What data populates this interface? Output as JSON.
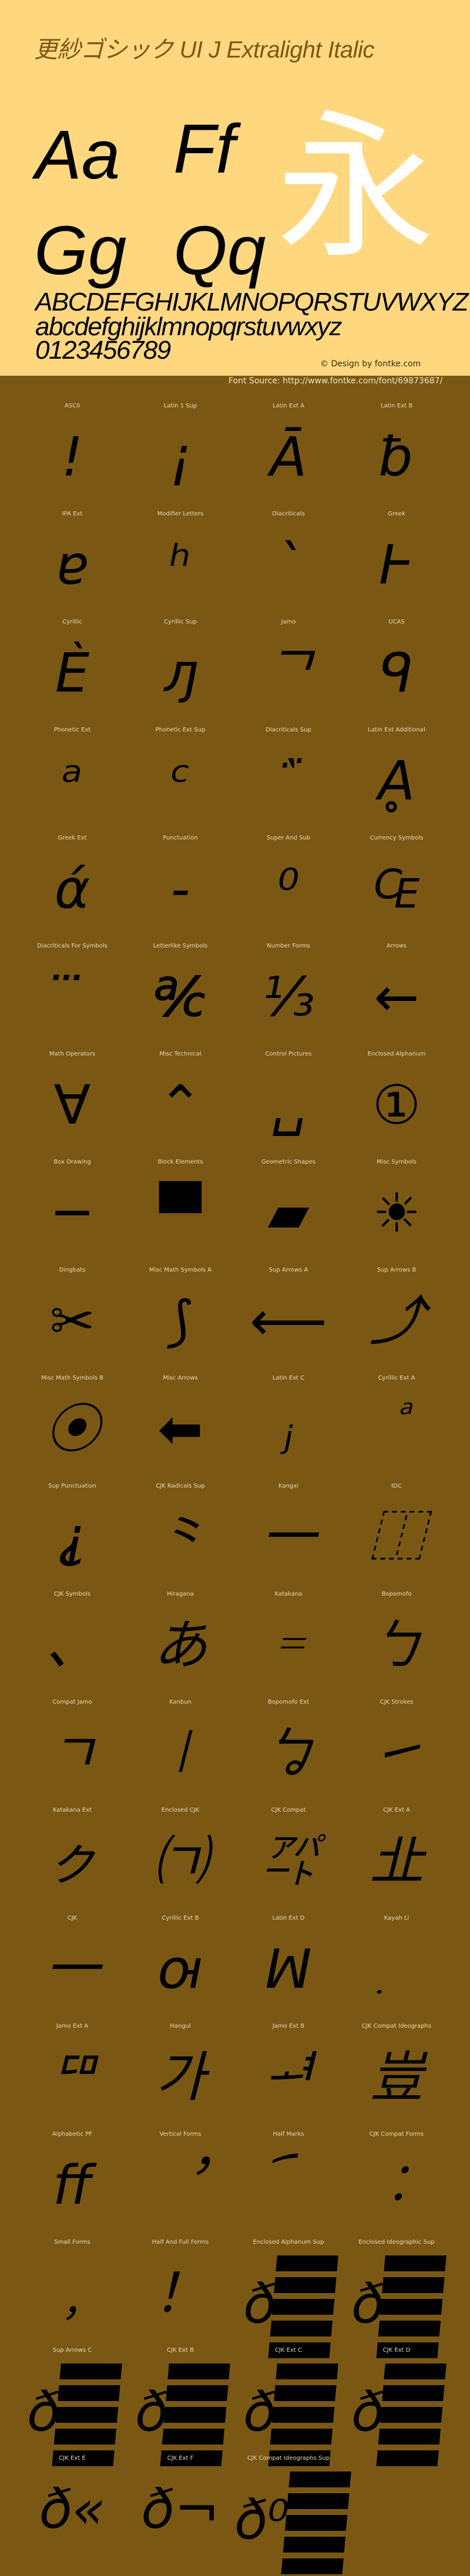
{
  "header": {
    "title": "更紗ゴシック UI J Extralight Italic",
    "sample_pairs": [
      "Aa",
      "Ff",
      "Gg",
      "Qq"
    ],
    "sample_kanji": "永",
    "uppercase": "ABCDEFGHIJKLMNOPQRSTUVWXYZ",
    "lowercase": "abcdefghijklmnopqrstuvwxyz",
    "digits": "0123456789",
    "design_credit": "© Design by fontke.com",
    "font_source": "Font Source: http://www.fontke.com/font/69873687/"
  },
  "colors": {
    "header_bg": "#FFD77F",
    "body_bg": "#7A5814",
    "glyph": "#000000",
    "label": "#EADCB8"
  },
  "blocks": [
    {
      "label": "ASCII",
      "glyph": "!"
    },
    {
      "label": "Latin 1 Sup",
      "glyph": "¡"
    },
    {
      "label": "Latin Ext A",
      "glyph": "Ā"
    },
    {
      "label": "Latin Ext B",
      "glyph": "ƀ"
    },
    {
      "label": "IPA Ext",
      "glyph": "ɐ"
    },
    {
      "label": "Modifier Letters",
      "glyph": "ʰ"
    },
    {
      "label": "Diacriticals",
      "glyph": "`"
    },
    {
      "label": "Greek",
      "glyph": "Ͱ"
    },
    {
      "label": "Cyrillic",
      "glyph": "Ѐ"
    },
    {
      "label": "Cyrillic Sup",
      "glyph": "ԓ"
    },
    {
      "label": "Jamo",
      "glyph": "ᄀ"
    },
    {
      "label": "UCAS",
      "glyph": "ᑫ"
    },
    {
      "label": "Phonetic Ext",
      "glyph": "ᵃ"
    },
    {
      "label": "Phonetic Ext Sup",
      "glyph": "ᶜ"
    },
    {
      "label": "Diacriticals Sup",
      "glyph": "᷀"
    },
    {
      "label": "Latin Ext Additional",
      "glyph": "Ḁ"
    },
    {
      "label": "Greek Ext",
      "glyph": "ά"
    },
    {
      "label": "Punctuation",
      "glyph": "‐"
    },
    {
      "label": "Super And Sub",
      "glyph": "⁰"
    },
    {
      "label": "Currency Symbols",
      "glyph": "₠"
    },
    {
      "label": "Diacriticals For Symbols",
      "glyph": "⃛"
    },
    {
      "label": "Letterlike Symbols",
      "glyph": "℀"
    },
    {
      "label": "Number Forms",
      "glyph": "⅓"
    },
    {
      "label": "Arrows",
      "glyph": "←"
    },
    {
      "label": "Math Operators",
      "glyph": "∀"
    },
    {
      "label": "Misc Technical",
      "glyph": "⌃"
    },
    {
      "label": "Control Pictures",
      "glyph": "␣"
    },
    {
      "label": "Enclosed Alphanum",
      "glyph": "①"
    },
    {
      "label": "Box Drawing",
      "glyph": "─"
    },
    {
      "label": "Block Elements",
      "glyph": "▀"
    },
    {
      "label": "Geometric Shapes",
      "glyph": "▰"
    },
    {
      "label": "Misc Symbols",
      "glyph": "☀"
    },
    {
      "label": "Dingbats",
      "glyph": "✂"
    },
    {
      "label": "Misc Math Symbols A",
      "glyph": "⟆"
    },
    {
      "label": "Sup Arrows A",
      "glyph": "⟵"
    },
    {
      "label": "Sup Arrows B",
      "glyph": "⤴"
    },
    {
      "label": "Misc Math Symbols B",
      "glyph": "⦿"
    },
    {
      "label": "Misc Arrows",
      "glyph": "⬅"
    },
    {
      "label": "Latin Ext C",
      "glyph": "ⱼ"
    },
    {
      "label": "Cyrillic Ext A",
      "glyph": "ⷶ"
    },
    {
      "label": "Sup Punctuation",
      "glyph": "⸘"
    },
    {
      "label": "CJK Radicals Sup",
      "glyph": "⺀"
    },
    {
      "label": "Kangxi",
      "glyph": "⼀"
    },
    {
      "label": "IDC",
      "glyph": "⿰"
    },
    {
      "label": "CJK Symbols",
      "glyph": "、"
    },
    {
      "label": "Hiragana",
      "glyph": "あ"
    },
    {
      "label": "Katakana",
      "glyph": "゠"
    },
    {
      "label": "Bopomofo",
      "glyph": "ㄅ"
    },
    {
      "label": "Compat Jamo",
      "glyph": "ㄱ"
    },
    {
      "label": "Kanbun",
      "glyph": "㆐"
    },
    {
      "label": "Bopomofo Ext",
      "glyph": "ㆠ"
    },
    {
      "label": "CJK Strokes",
      "glyph": "㇀"
    },
    {
      "label": "Katakana Ext",
      "glyph": "ㇰ"
    },
    {
      "label": "Enclosed CJK",
      "glyph": "㈀"
    },
    {
      "label": "CJK Compat",
      "glyph": "㌀"
    },
    {
      "label": "CJK Ext A",
      "glyph": "㐀"
    },
    {
      "label": "CJK",
      "glyph": "一"
    },
    {
      "label": "Cyrillic Ext B",
      "glyph": "ꙕ"
    },
    {
      "label": "Latin Ext D",
      "glyph": "ꟽ"
    },
    {
      "label": "Kayah Li",
      "glyph": "꤫"
    },
    {
      "label": "Jamo Ext A",
      "glyph": "ꥠ"
    },
    {
      "label": "Hangul",
      "glyph": "가"
    },
    {
      "label": "Jamo Ext B",
      "glyph": "ힰ"
    },
    {
      "label": "CJK Compat Ideographs",
      "glyph": "豈"
    },
    {
      "label": "Alphabetic PF",
      "glyph": "ﬀ"
    },
    {
      "label": "Vertical Forms",
      "glyph": "︐"
    },
    {
      "label": "Half Marks",
      "glyph": "︠"
    },
    {
      "label": "CJK Compat Forms",
      "glyph": "︰"
    },
    {
      "label": "Small Forms",
      "glyph": "﹐"
    },
    {
      "label": "Half And Full Forms",
      "glyph": "！"
    },
    {
      "label": "Enclosed Alphanum Sup",
      "glyph": "ð",
      "tofu": true
    },
    {
      "label": "Enclosed Ideographic Sup",
      "glyph": "ð",
      "tofu": true
    },
    {
      "label": "Sup Arrows C",
      "glyph": "ð",
      "tofu": true
    },
    {
      "label": "CJK Ext B",
      "glyph": "ð",
      "tofu": true
    },
    {
      "label": "CJK Ext C",
      "glyph": "ð",
      "tofu": true
    },
    {
      "label": "CJK Ext D",
      "glyph": "ð",
      "tofu": true
    },
    {
      "label": "CJK Ext E",
      "glyph": "ð«"
    },
    {
      "label": "CJK Ext F",
      "glyph": "ð¬"
    },
    {
      "label": "CJK Compat Ideographs Sup",
      "glyph": "ð⁰",
      "tofu": true
    }
  ]
}
